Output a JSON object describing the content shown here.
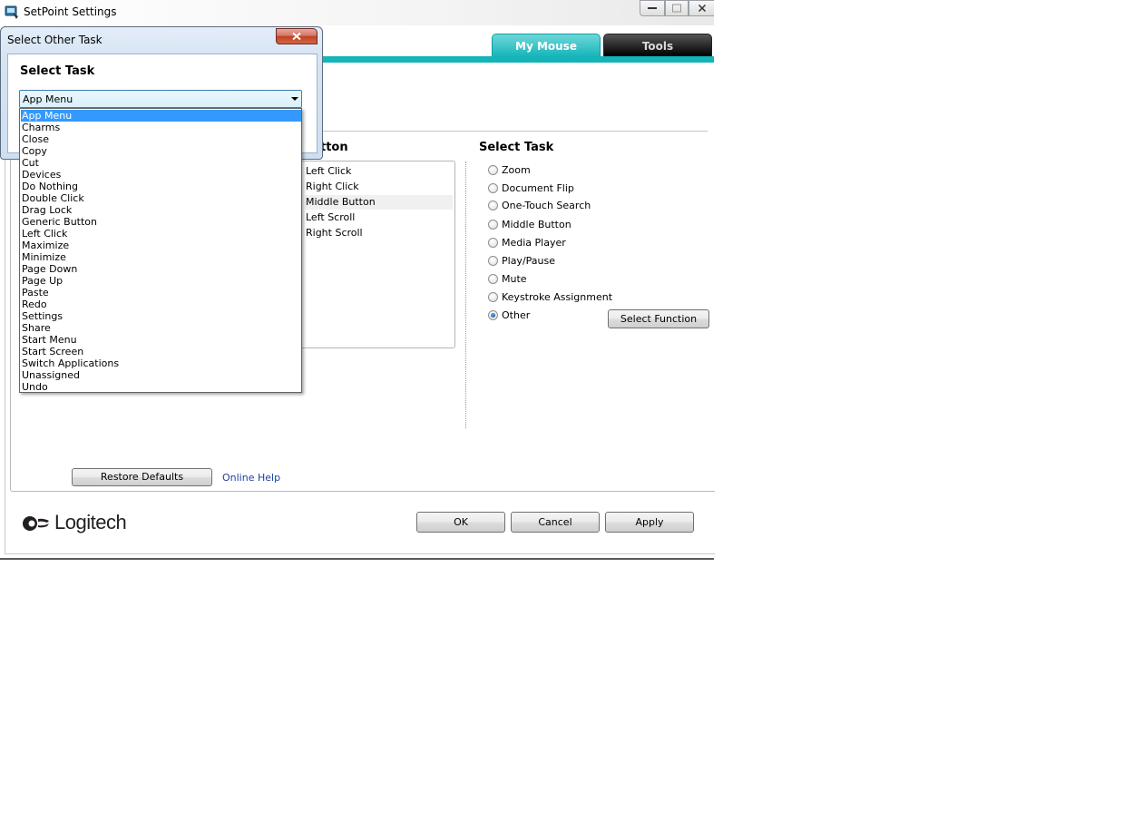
{
  "window": {
    "title": "SetPoint Settings"
  },
  "tabs": [
    {
      "label": "My Mouse",
      "active": true
    },
    {
      "label": "Tools",
      "active": false
    }
  ],
  "button_panel": {
    "heading_partial": "tton",
    "items": [
      "Left Click",
      "Right Click",
      "Middle Button",
      "Left Scroll",
      "Right Scroll"
    ],
    "selected": "Middle Button"
  },
  "select_task": {
    "heading": "Select Task",
    "options": [
      "Zoom",
      "Document Flip",
      "One-Touch Search",
      "Middle Button",
      "Media Player",
      "Play/Pause",
      "Mute",
      "Keystroke Assignment",
      "Other"
    ],
    "selected": "Other",
    "select_function_label": "Select Function"
  },
  "footer": {
    "restore_defaults_label": "Restore Defaults",
    "online_help_label": "Online Help",
    "ok_label": "OK",
    "cancel_label": "Cancel",
    "apply_label": "Apply",
    "brand": "Logitech"
  },
  "dialog": {
    "title": "Select Other Task",
    "heading": "Select Task",
    "combo_value": "App Menu",
    "options": [
      "App Menu",
      "Charms",
      "Close",
      "Copy",
      "Cut",
      "Devices",
      "Do Nothing",
      "Double Click",
      "Drag Lock",
      "Generic Button",
      "Left Click",
      "Maximize",
      "Minimize",
      "Page Down",
      "Page Up",
      "Paste",
      "Redo",
      "Settings",
      "Share",
      "Start Menu",
      "Start Screen",
      "Switch Applications",
      "Unassigned",
      "Undo"
    ],
    "highlighted": "App Menu"
  },
  "colors": {
    "accent_teal": "#14b4b8",
    "selection_blue": "#3399ff",
    "link_blue": "#1a3fa0"
  }
}
